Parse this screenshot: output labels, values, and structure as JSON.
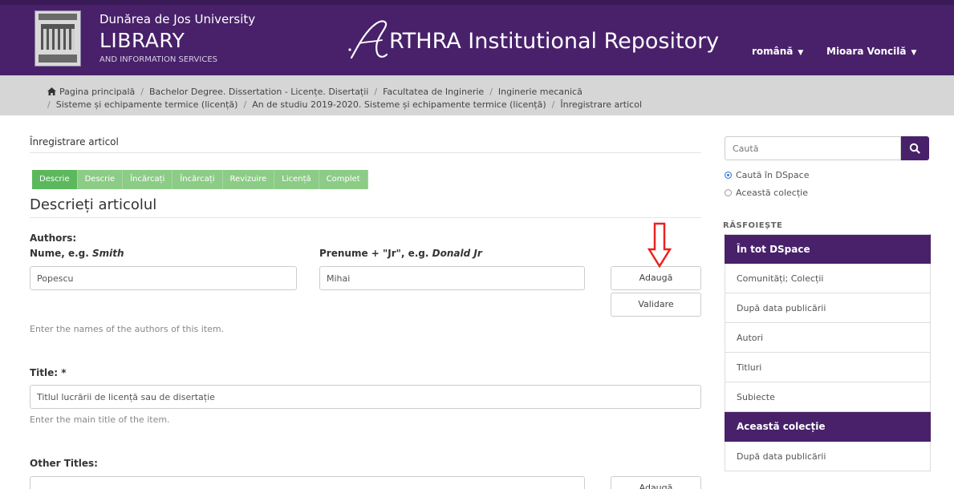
{
  "header": {
    "university": "Dunărea de Jos University",
    "library": "LIBRARY",
    "library_sub": "AND INFORMATION SERVICES",
    "repo_title": "RTHRA Institutional Repository",
    "language": "română",
    "user": "Mioara Voncilă"
  },
  "breadcrumb": {
    "items": [
      "Pagina principală",
      "Bachelor Degree. Dissertation - Licențe. Disertații",
      "Facultatea de Inginerie",
      "Inginerie mecanică",
      "Sisteme și echipamente termice (licență)",
      "An de studiu 2019-2020. Sisteme și echipamente termice (licență)",
      "Înregistrare articol"
    ]
  },
  "main": {
    "heading": "Înregistrare articol",
    "steps": [
      "Descrie",
      "Descrie",
      "Încărcați",
      "Încărcați",
      "Revizuire",
      "Licență",
      "Complet"
    ],
    "section_title": "Descrieți articolul",
    "authors": {
      "label": "Authors:",
      "last_label_prefix": "Nume, e.g. ",
      "last_label_example": "Smith",
      "first_label_prefix": "Prenume + \"Jr\", e.g. ",
      "first_label_example": "Donald Jr",
      "last_value": "Popescu",
      "first_value": "Mihai",
      "add_button": "Adaugă",
      "validate_button": "Validare",
      "help": "Enter the names of the authors of this item."
    },
    "title": {
      "label": "Title: *",
      "value": "Titlul lucrării de licență sau de disertație",
      "help": "Enter the main title of the item."
    },
    "other_titles": {
      "label": "Other Titles:",
      "add_button": "Adaugă"
    }
  },
  "sidebar": {
    "search_placeholder": "Caută",
    "scope_all": "Caută în DSpace",
    "scope_collection": "Această colecție",
    "browse_title": "RĂSFOIEȘTE",
    "all_header": "În tot DSpace",
    "all_items": [
      "Comunități; Colecții",
      "După data publicării",
      "Autori",
      "Titluri",
      "Subiecte"
    ],
    "collection_header": "Această colecție",
    "collection_items": [
      "După data publicării"
    ]
  },
  "colors": {
    "brand_purple": "#48216a",
    "step_green": "#5cb85c",
    "arrow_red": "#e8231f"
  }
}
